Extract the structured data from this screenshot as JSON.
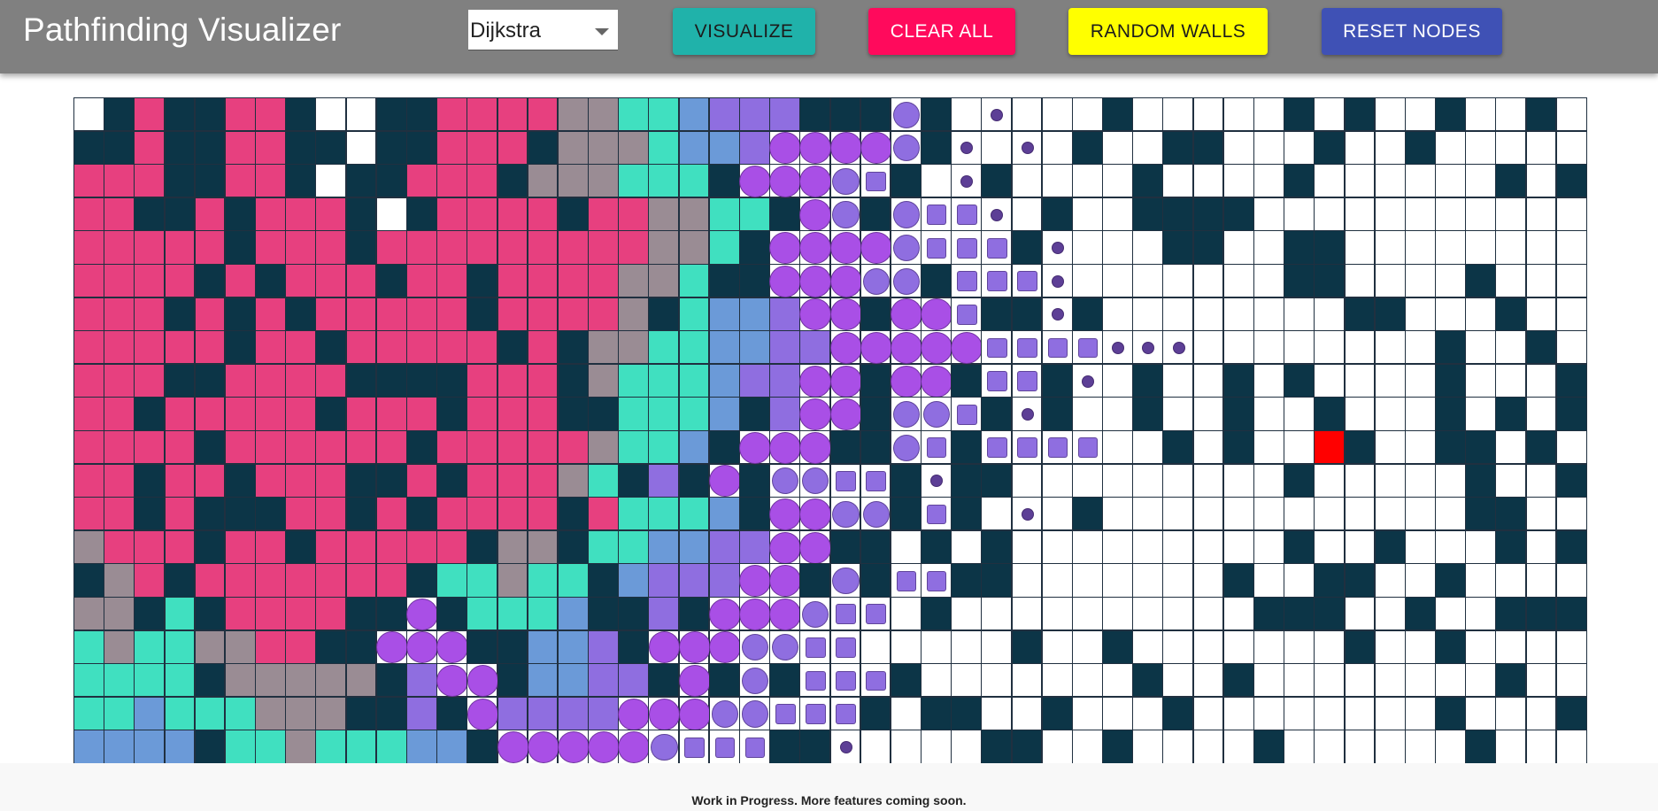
{
  "header": {
    "title": "Pathfinding Visualizer",
    "algorithm_select": {
      "selected": "Dijkstra"
    },
    "buttons": {
      "visualize": {
        "label": "VISUALIZE",
        "color": "#20b2aa"
      },
      "clear_all": {
        "label": "CLEAR ALL",
        "color": "#ff0a5c"
      },
      "random_walls": {
        "label": "RANDOM WALLS",
        "color": "#ffff00"
      },
      "reset_nodes": {
        "label": "RESET NODES",
        "color": "#3f51b5"
      }
    }
  },
  "grid": {
    "rows": 20,
    "cols": 50,
    "legend": {
      "E": "empty",
      "W": "wall",
      "P": "visited-pink",
      "G": "visited-gray",
      "T": "visited-teal",
      "B": "visited-blue",
      "V": "visited-violet",
      "C": "frontier-large-circle",
      "M": "frontier-medium-circle",
      "s": "frontier-small-square",
      "d": "frontier-dot",
      "R": "target-node"
    },
    "colors": {
      "empty": "#ffffff",
      "wall": "#0c3547",
      "pink": "#e7407f",
      "gray": "#9a8c94",
      "teal": "#40e0c0",
      "blue": "#6b9ad8",
      "violet": "#8f6ee0",
      "purple": "#a94fe6",
      "dot": "#5d3f96",
      "target": "#ff0000"
    },
    "cells": [
      "EWPWWPPWEEWWPPPPGGTTBVVVWWWMWEdEEEWEEEEEWEWEEWEEWE",
      "WWPWWPPWWEWWPPPWGGGTBBVCCCCMWdEdEWEEWWEEEWEEWEEEEE",
      "PPPWWPPWEWWPPPWGGGTTTWCCCMsWEdWEEEEWEEEEWEEEEEEWEW",
      "PPWWPWPPPWEWPPPPWPPGGTTWCMWMssdEWEEWWWWEEEEEEEEEEE",
      "PPPPPWPPPWPPPPPPPPPGGTWCCCCMsssWdEEEWWEEWWEEEEEEEE",
      "PPPPWPWPPPWPPWPPPPGGTWWCCCMMWsssdEEEEEEEWWEEEEWEEE",
      "PPPWPWPWPPPPPWPPPPGWTBBVCCWCCsWWdWEEEEEEEEWWEEEWEE",
      "PPPPPWPPWPPPPPWPWGGTTBBVVCCCCCssssdddEEEEEEEEWEEWEE",
      "PPPWWPPPPWWWWPPPWGTTTBVVCCWCCWssWdEWEEWEWEEEEWEEEW",
      "PPWPPPPPWPPPWPPPWWTTTBWVCCWMMsWdWEEWEEWEEWEEEWEWEW",
      "PPPPWPPPPPPWPPPPPGTTBWCCCWWMsWssssEEWEWEERWEEWWEWEW",
      "PPWPPWPPPWWPWPPPGTWVWCWMMssWdWWEEEEEEEEEWEEEEEWEEW",
      "PPWPWWWPPWPWPPPPWPTTTBWCCMMWsWEdEWEEEEEEEEEEEEWWEEEE",
      "GPPPWPPWPPPPPWGGWTTBBVVCCWWEWEWEEEEEEEEEWEEWEEEWEW",
      "WGPWPPPPPPPWTTGTTWBVVVCCWMWssWWEEEEEEEWEEWWEEWEEEE",
      "GGWTWPPPPWWCWTTTBWWVWCCCMssEWEEEEEEEEEEWWWEEWEEWWW",
      "TGTTGGPPWWCCCWWBBVWCCCMMssEEEEEWEEWEEEEEEEWEEWEEEE",
      "TTTTWGGGGGWVCCWBBVVWCWMWsssWEEEEEEEWEEWEEEEEEEEWEE",
      "TTBTTTGGGWWVWCVVVVCCCMMsssWEWWEEWEEEWEEEEEEEEWEEEW",
      "BBBBWTTGTTTBBWCCCCCMsssWWdEEEEWWEEWEEEEWEEEEEEWEEE"
    ]
  },
  "footer": {
    "text": "Work in Progress. More features coming soon."
  }
}
